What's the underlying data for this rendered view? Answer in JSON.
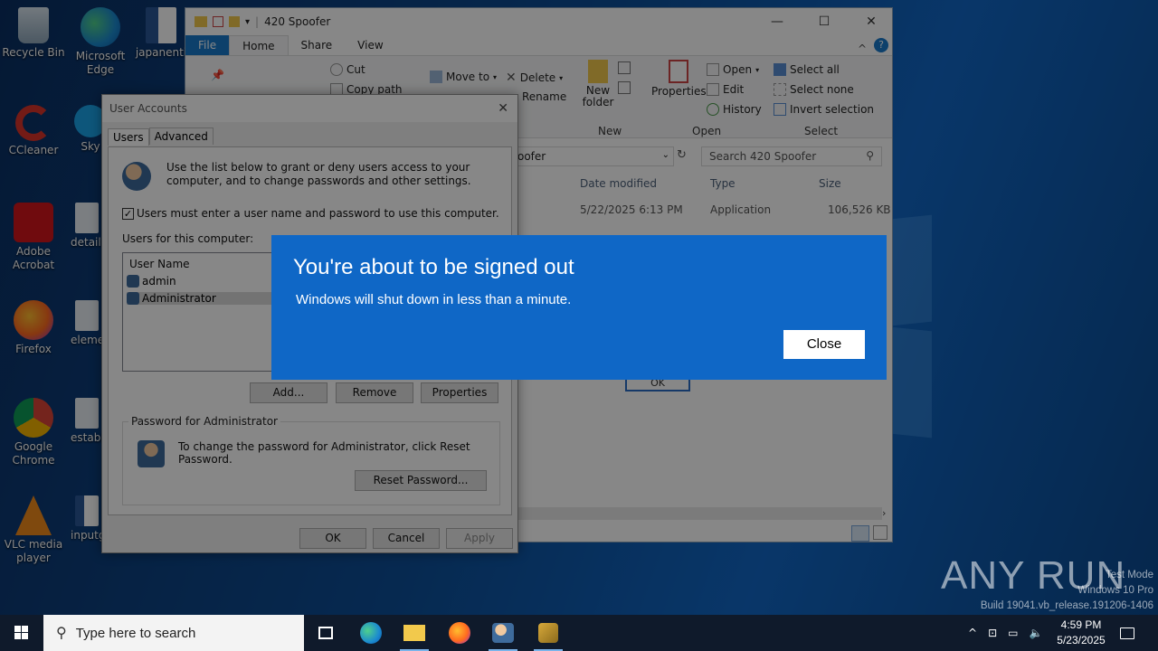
{
  "desktop": {
    "icons": [
      {
        "label": "Recycle Bin",
        "icon": "recycle-bin-icon"
      },
      {
        "label": "Microsoft Edge",
        "icon": "edge-icon"
      },
      {
        "label": "japanenti",
        "icon": "word-doc-icon"
      },
      {
        "label": "CCleaner",
        "icon": "ccleaner-icon"
      },
      {
        "label": "Sky",
        "icon": "skype-icon"
      },
      {
        "label": "Adobe Acrobat",
        "icon": "acrobat-icon"
      },
      {
        "label": "details",
        "icon": "image-file-icon"
      },
      {
        "label": "Firefox",
        "icon": "firefox-icon"
      },
      {
        "label": "eleme",
        "icon": "image-file-icon"
      },
      {
        "label": "Google Chrome",
        "icon": "chrome-icon"
      },
      {
        "label": "establ",
        "icon": "image-file-icon"
      },
      {
        "label": "VLC media player",
        "icon": "vlc-icon"
      },
      {
        "label": "inputg",
        "icon": "word-doc-icon"
      }
    ]
  },
  "explorer": {
    "title": "420 Spoofer",
    "tabs": [
      "File",
      "Home",
      "Share",
      "View"
    ],
    "ribbon": {
      "cut": "Cut",
      "copy_path": "Copy path",
      "move_to": "Move to",
      "delete": "Delete",
      "rename": "Rename",
      "new_folder": "New folder",
      "new_group": "New",
      "properties": "Properties",
      "open": "Open",
      "edit": "Edit",
      "history": "History",
      "open_group": "Open",
      "select_all": "Select all",
      "select_none": "Select none",
      "invert_selection": "Invert selection",
      "select_group": "Select"
    },
    "address_tail": "oofer",
    "search_placeholder": "Search 420 Spoofer",
    "columns": {
      "date": "Date modified",
      "type": "Type",
      "size": "Size"
    },
    "row": {
      "date": "5/22/2025 6:13 PM",
      "type": "Application",
      "size": "106,526 KB"
    },
    "hidden_ok": "OK"
  },
  "user_accounts": {
    "title": "User Accounts",
    "tabs": [
      "Users",
      "Advanced"
    ],
    "intro": "Use the list below to grant or deny users access to your computer, and to change passwords and other settings.",
    "checkbox_label": "Users must enter a user name and password to use this computer.",
    "checkbox_checked": true,
    "users_label": "Users for this computer:",
    "list_header": "User Name",
    "users": [
      "admin",
      "Administrator"
    ],
    "buttons": {
      "add": "Add...",
      "remove": "Remove",
      "properties": "Properties"
    },
    "password_group": "Password for Administrator",
    "password_text": "To change the password for Administrator, click Reset Password.",
    "reset_button": "Reset Password...",
    "footer": {
      "ok": "OK",
      "cancel": "Cancel",
      "apply": "Apply"
    }
  },
  "signout_dialog": {
    "title": "You're about to be signed out",
    "message": "Windows will shut down in less than a minute.",
    "close_button": "Close",
    "color": "#0f67c6"
  },
  "taskbar": {
    "search_placeholder": "Type here to search",
    "time": "4:59 PM",
    "date": "5/23/2025"
  },
  "watermark": {
    "brand": "ANY RUN",
    "mode": "Test Mode",
    "edition": "Windows 10 Pro",
    "build": "Build 19041.vb_release.191206-1406"
  }
}
